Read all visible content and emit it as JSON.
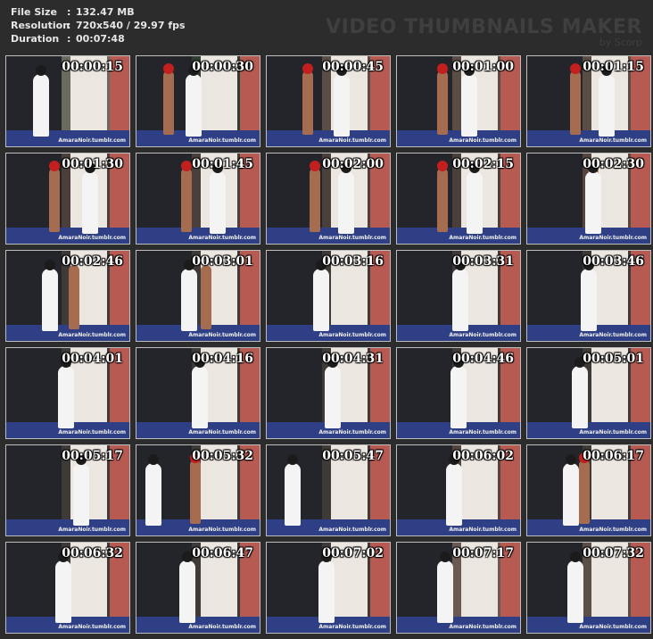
{
  "info": {
    "file_size_label": "File Size",
    "file_size_value": "132.47 MB",
    "resolution_label": "Resolution",
    "resolution_value": "720x540 / 29.97 fps",
    "duration_label": "Duration",
    "duration_value": "00:07:48",
    "separator": ":"
  },
  "brand": {
    "title": "VIDEO THUMBNAILS MAKER",
    "subtitle": "by Scorp"
  },
  "watermark": "AmaraNoir.tumblr.com",
  "thumbnails": [
    {
      "time": "00:00:15"
    },
    {
      "time": "00:00:30"
    },
    {
      "time": "00:00:45"
    },
    {
      "time": "00:01:00"
    },
    {
      "time": "00:01:15"
    },
    {
      "time": "00:01:30"
    },
    {
      "time": "00:01:45"
    },
    {
      "time": "00:02:00"
    },
    {
      "time": "00:02:15"
    },
    {
      "time": "00:02:30"
    },
    {
      "time": "00:02:46"
    },
    {
      "time": "00:03:01"
    },
    {
      "time": "00:03:16"
    },
    {
      "time": "00:03:31"
    },
    {
      "time": "00:03:46"
    },
    {
      "time": "00:04:01"
    },
    {
      "time": "00:04:16"
    },
    {
      "time": "00:04:31"
    },
    {
      "time": "00:04:46"
    },
    {
      "time": "00:05:01"
    },
    {
      "time": "00:05:17"
    },
    {
      "time": "00:05:32"
    },
    {
      "time": "00:05:47"
    },
    {
      "time": "00:06:02"
    },
    {
      "time": "00:06:17"
    },
    {
      "time": "00:06:32"
    },
    {
      "time": "00:06:47"
    },
    {
      "time": "00:07:02"
    },
    {
      "time": "00:07:17"
    },
    {
      "time": "00:07:32"
    }
  ]
}
